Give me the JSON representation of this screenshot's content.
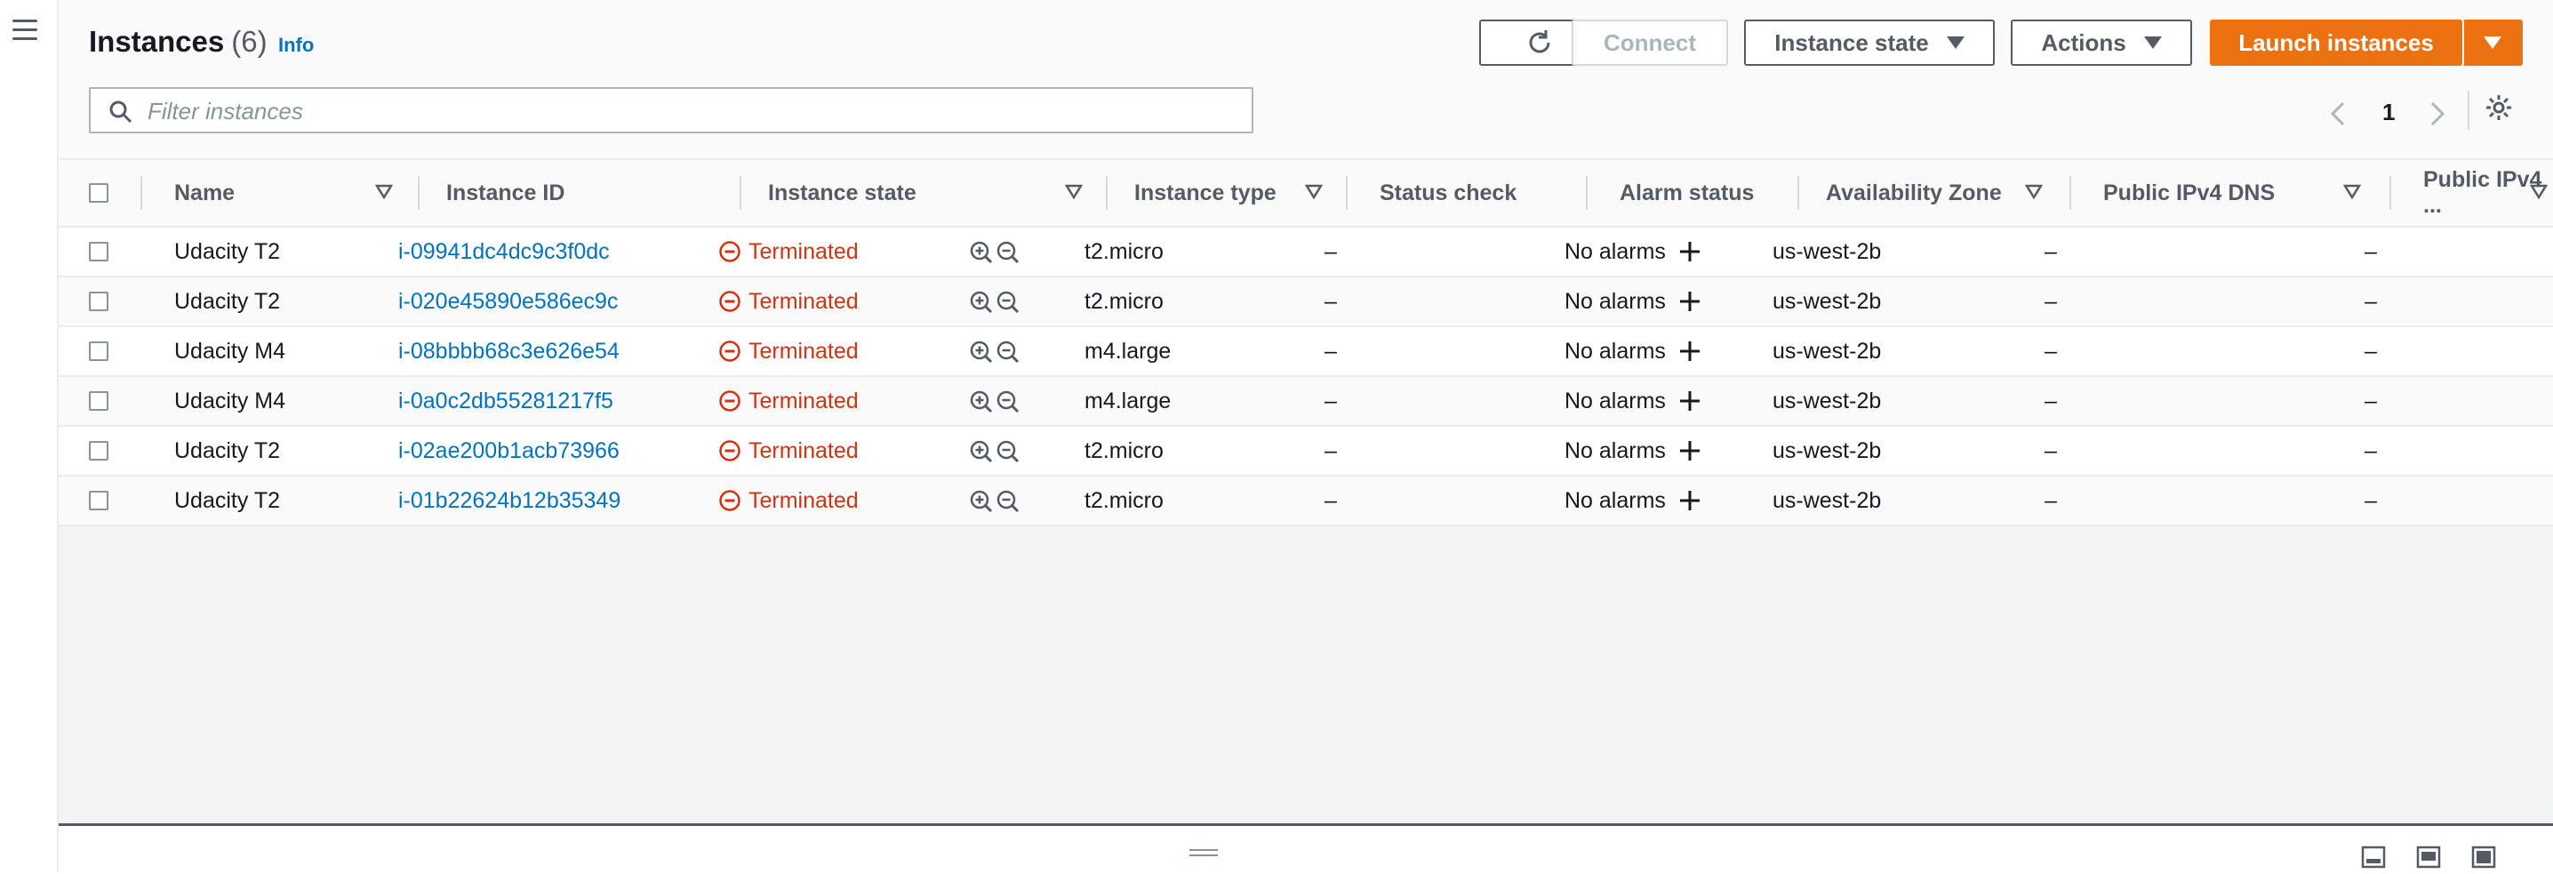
{
  "header": {
    "title": "Instances",
    "count": "(6)",
    "info": "Info",
    "buttons": {
      "connect": "Connect",
      "instance_state": "Instance state",
      "actions": "Actions",
      "launch": "Launch instances"
    },
    "search_placeholder": "Filter instances",
    "page_number": "1"
  },
  "table": {
    "columns": [
      "Name",
      "Instance ID",
      "Instance state",
      "Instance type",
      "Status check",
      "Alarm status",
      "Availability Zone",
      "Public IPv4 DNS",
      "Public IPv4 ..."
    ],
    "rows": [
      {
        "name": "Udacity T2",
        "id": "i-09941dc4dc9c3f0dc",
        "state": "Terminated",
        "type": "t2.micro",
        "status": "–",
        "alarm": "No alarms",
        "zone": "us-west-2b",
        "dns": "–",
        "ip": "–"
      },
      {
        "name": "Udacity T2",
        "id": "i-020e45890e586ec9c",
        "state": "Terminated",
        "type": "t2.micro",
        "status": "–",
        "alarm": "No alarms",
        "zone": "us-west-2b",
        "dns": "–",
        "ip": "–"
      },
      {
        "name": "Udacity M4",
        "id": "i-08bbbb68c3e626e54",
        "state": "Terminated",
        "type": "m4.large",
        "status": "–",
        "alarm": "No alarms",
        "zone": "us-west-2b",
        "dns": "–",
        "ip": "–"
      },
      {
        "name": "Udacity M4",
        "id": "i-0a0c2db55281217f5",
        "state": "Terminated",
        "type": "m4.large",
        "status": "–",
        "alarm": "No alarms",
        "zone": "us-west-2b",
        "dns": "–",
        "ip": "–"
      },
      {
        "name": "Udacity T2",
        "id": "i-02ae200b1acb73966",
        "state": "Terminated",
        "type": "t2.micro",
        "status": "–",
        "alarm": "No alarms",
        "zone": "us-west-2b",
        "dns": "–",
        "ip": "–"
      },
      {
        "name": "Udacity T2",
        "id": "i-01b22624b12b35349",
        "state": "Terminated",
        "type": "t2.micro",
        "status": "–",
        "alarm": "No alarms",
        "zone": "us-west-2b",
        "dns": "–",
        "ip": "–"
      }
    ]
  },
  "colors": {
    "accent": "#ec7211",
    "link": "#0073bb",
    "terminated": "#d13212"
  }
}
